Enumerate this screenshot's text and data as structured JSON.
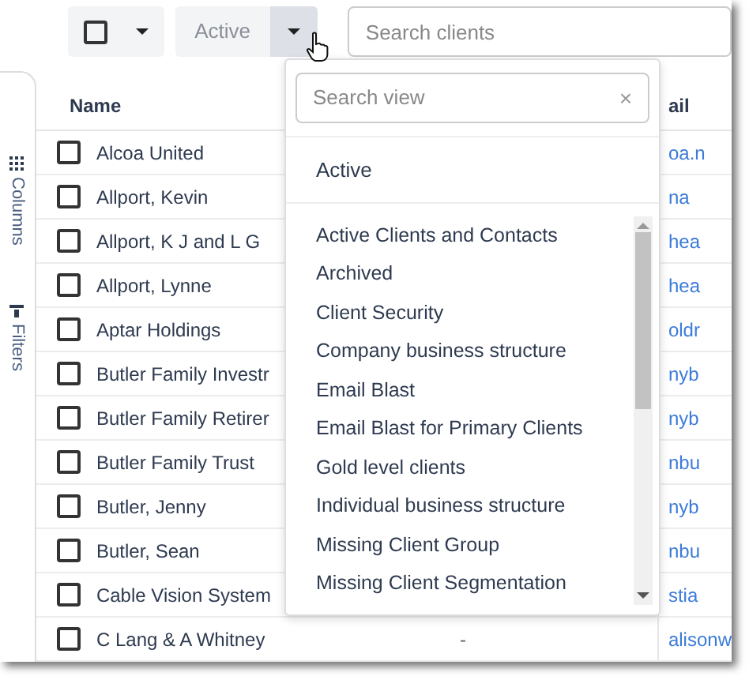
{
  "toolbar": {
    "select_all": {
      "checked": false
    },
    "view_button": {
      "label": "Active",
      "expanded": true
    },
    "search": {
      "placeholder": "Search clients"
    }
  },
  "side_tabs": [
    {
      "label": "Columns"
    },
    {
      "label": "Filters"
    }
  ],
  "table": {
    "columns": [
      {
        "label": "Name"
      },
      {
        "label": "ail"
      }
    ],
    "rows": [
      {
        "checked": false,
        "name": "Alcoa United",
        "email": "oa.n"
      },
      {
        "checked": false,
        "name": "Allport, Kevin",
        "email": "na"
      },
      {
        "checked": false,
        "name": "Allport, K J and L G",
        "email": "hea"
      },
      {
        "checked": false,
        "name": "Allport, Lynne",
        "email": "hea"
      },
      {
        "checked": false,
        "name": "Aptar Holdings",
        "email": "oldr"
      },
      {
        "checked": false,
        "name": "Butler Family Investr",
        "email": "nyb"
      },
      {
        "checked": false,
        "name": "Butler Family Retirer",
        "email": "nyb"
      },
      {
        "checked": false,
        "name": "Butler Family Trust",
        "email": "nbu"
      },
      {
        "checked": false,
        "name": "Butler, Jenny",
        "email": "nyb"
      },
      {
        "checked": false,
        "name": "Butler, Sean",
        "email": "nbu"
      },
      {
        "checked": false,
        "name": "Cable Vision System",
        "email": "stia"
      },
      {
        "checked": false,
        "name": "C Lang & A Whitney",
        "column_2": "-",
        "email": "alisonw"
      }
    ]
  },
  "view_menu": {
    "search": {
      "placeholder": "Search view",
      "clear": "×"
    },
    "current": {
      "label": "Active"
    },
    "items": [
      {
        "label": "Active Clients and Contacts",
        "selected": false
      },
      {
        "label": "Archived",
        "selected": false
      },
      {
        "label": "Client Security",
        "selected": false
      },
      {
        "label": "Company business structure",
        "selected": false
      },
      {
        "label": "Email Blast",
        "selected": false
      },
      {
        "label": "Email Blast for Primary Clients",
        "selected": false
      },
      {
        "label": "Gold level clients",
        "selected": false
      },
      {
        "label": "Individual business structure",
        "selected": false
      },
      {
        "label": "Missing Client Group",
        "selected": false
      },
      {
        "label": "Missing Client Segmentation",
        "selected": false
      }
    ]
  }
}
